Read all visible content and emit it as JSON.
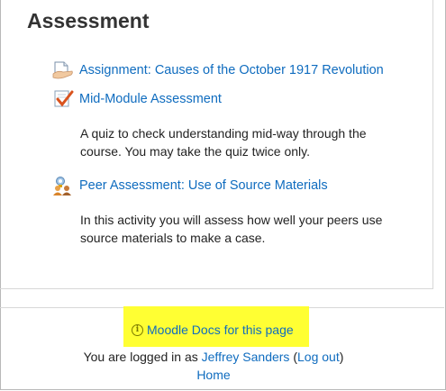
{
  "section": {
    "title": "Assessment"
  },
  "activities": [
    {
      "name": "Assignment: Causes of the October 1917 Revolution",
      "icon": "assignment-icon"
    },
    {
      "name": "Mid-Module Assessment",
      "icon": "quiz-icon",
      "description": "A quiz to check understanding mid-way through the course. You may take the quiz twice only."
    },
    {
      "name": "Peer Assessment: Use of Source Materials",
      "icon": "workshop-icon",
      "description": "In this activity you will assess how well your peers use source materials to make a case."
    }
  ],
  "footer": {
    "docs_link": "Moodle Docs for this page",
    "logged_in_prefix": "You are logged in as",
    "user_name": "Jeffrey Sanders",
    "open_paren": " (",
    "logout": "Log out",
    "close_paren": ")",
    "home": "Home",
    "highlight_color": "#ffff33",
    "link_color": "#0f6cbf"
  }
}
